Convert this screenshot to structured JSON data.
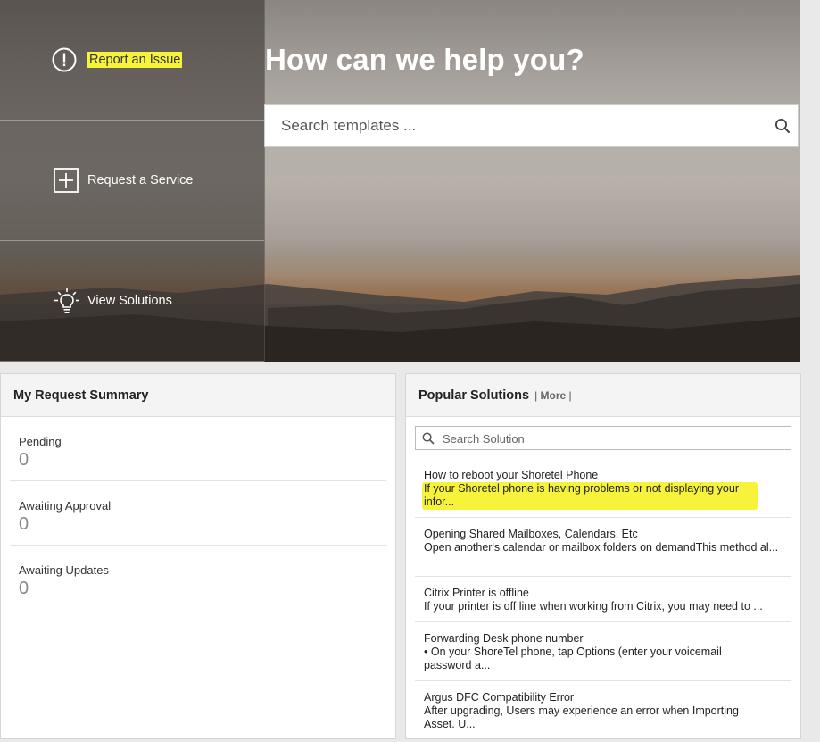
{
  "hero": {
    "title": "How can we help you?",
    "search_placeholder": "Search templates ..."
  },
  "menu": [
    {
      "label": "Report an Issue",
      "icon": "exclamation-circle-icon"
    },
    {
      "label": "Request a Service",
      "icon": "plus-square-icon"
    },
    {
      "label": "View Solutions",
      "icon": "lightbulb-icon"
    }
  ],
  "summary": {
    "title": "My Request Summary",
    "rows": [
      {
        "label": "Pending",
        "value": "0"
      },
      {
        "label": "Awaiting Approval",
        "value": "0"
      },
      {
        "label": "Awaiting Updates",
        "value": "0"
      }
    ]
  },
  "solutions": {
    "title": "Popular Solutions",
    "more_prefix": "| ",
    "more_label": "More",
    "more_suffix": " |",
    "search_placeholder": "Search Solution",
    "items": [
      {
        "title": "How to reboot your Shoretel Phone",
        "desc": "If your Shoretel phone is having problems or not displaying your infor..."
      },
      {
        "title": "Opening Shared Mailboxes, Calendars, Etc",
        "desc": "Open another's calendar or mailbox folders on demandThis method al..."
      },
      {
        "title": "Citrix Printer is offline",
        "desc": "If your printer is off line when working from Citrix, you may need to ..."
      },
      {
        "title": "Forwarding Desk phone number",
        "desc": "• On your ShoreTel phone, tap Options (enter your voicemail password a..."
      },
      {
        "title": "Argus DFC Compatibility Error",
        "desc": "After upgrading, Users may experience an error when Importing Asset. U..."
      }
    ]
  },
  "colors": {
    "highlight": "#f7f33a"
  }
}
